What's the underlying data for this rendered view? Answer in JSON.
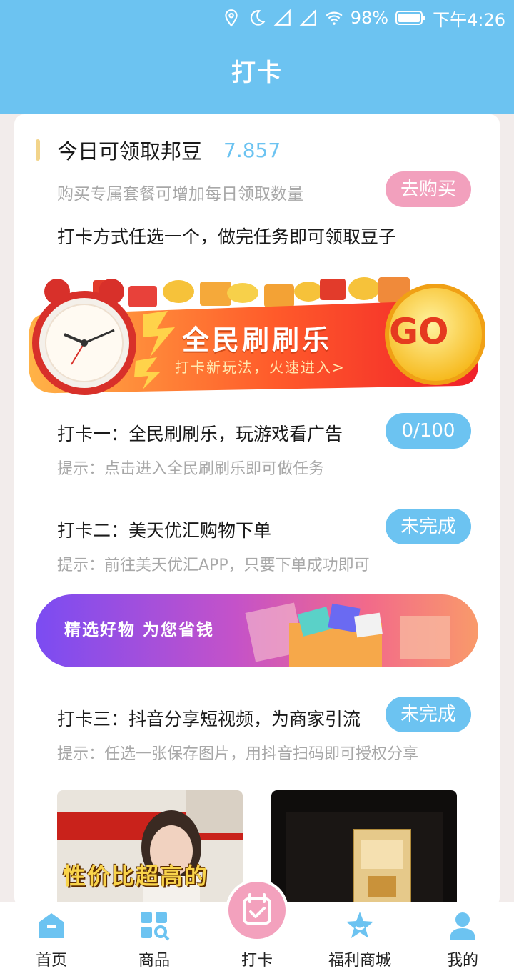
{
  "status_bar": {
    "battery": "98%",
    "time": "下午4:26",
    "icons": [
      "location-icon",
      "moon-icon",
      "signal-icon",
      "signal-icon",
      "wifi-icon",
      "battery-icon"
    ]
  },
  "header": {
    "title": "打卡"
  },
  "today": {
    "label": "今日可领取邦豆",
    "value": "7.857"
  },
  "buy": {
    "hint": "购买专属套餐可增加每日领取数量",
    "button": "去购买"
  },
  "method_title": "打卡方式任选一个，做完任务即可领取豆子",
  "promo_banner": {
    "title": "全民刷刷乐",
    "subtitle": "打卡新玩法，火速进入>",
    "go": "GO"
  },
  "tasks": [
    {
      "title": "打卡一：全民刷刷乐，玩游戏看广告",
      "hint": "提示：点击进入全民刷刷乐即可做任务",
      "badge": "0/100"
    },
    {
      "title": "打卡二：美天优汇购物下单",
      "hint": "提示：前往美天优汇APP，只要下单成功即可",
      "badge": "未完成"
    },
    {
      "title": "打卡三：抖音分享短视频，为商家引流",
      "hint": "提示：任选一张保存图片，用抖音扫码即可授权分享",
      "badge": "未完成"
    }
  ],
  "shop_banner": {
    "text": "精选好物 为您省钱"
  },
  "thumbnails": [
    {
      "caption": "性价比超高的"
    }
  ],
  "tabbar": {
    "items": [
      {
        "label": "首页",
        "icon": "home-icon"
      },
      {
        "label": "商品",
        "icon": "grid-search-icon"
      },
      {
        "label": "打卡",
        "icon": "calendar-check-icon"
      },
      {
        "label": "福利商城",
        "icon": "star-icon"
      },
      {
        "label": "我的",
        "icon": "user-icon"
      }
    ]
  },
  "colors": {
    "primary": "#6cc3f1",
    "pink": "#f2a0bd",
    "hint_gray": "#a8a8a8"
  }
}
